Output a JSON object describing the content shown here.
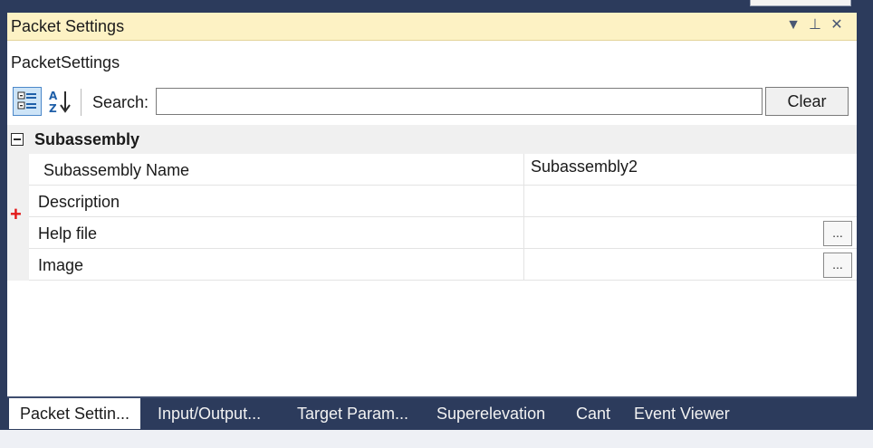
{
  "panel": {
    "title": "Packet Settings",
    "controls": {
      "dropdown": "▼",
      "pin": "⊥",
      "close": "✕"
    },
    "object_name": "PacketSettings"
  },
  "toolbar": {
    "categorized_icon": "categorized-icon",
    "alphabetical_icon": "sort-az-icon",
    "search_label": "Search:",
    "search_value": "",
    "search_placeholder": "",
    "clear_label": "Clear"
  },
  "category": {
    "label": "Subassembly"
  },
  "properties": [
    {
      "name": "Subassembly Name",
      "value": "Subassembly2",
      "has_ellipsis": false
    },
    {
      "name": "Description",
      "value": "",
      "has_ellipsis": false
    },
    {
      "name": "Help file",
      "value": "",
      "has_ellipsis": true
    },
    {
      "name": "Image",
      "value": "",
      "has_ellipsis": true
    }
  ],
  "ellipsis_label": "...",
  "plus_mark": "+",
  "tabs": [
    {
      "label": "Packet Settin...",
      "active": true
    },
    {
      "label": "Input/Output...",
      "active": false
    },
    {
      "label": "Target Param...",
      "active": false
    },
    {
      "label": "Superelevation",
      "active": false
    },
    {
      "label": "Cant",
      "active": false
    },
    {
      "label": "Event Viewer",
      "active": false
    }
  ],
  "colors": {
    "background": "#2c3b5c",
    "titlebar": "#fdf2c4",
    "panel": "#ffffff",
    "category_bg": "#f0f0f0",
    "active_tab": "#ffffff",
    "accent_red": "#e21a1a"
  }
}
